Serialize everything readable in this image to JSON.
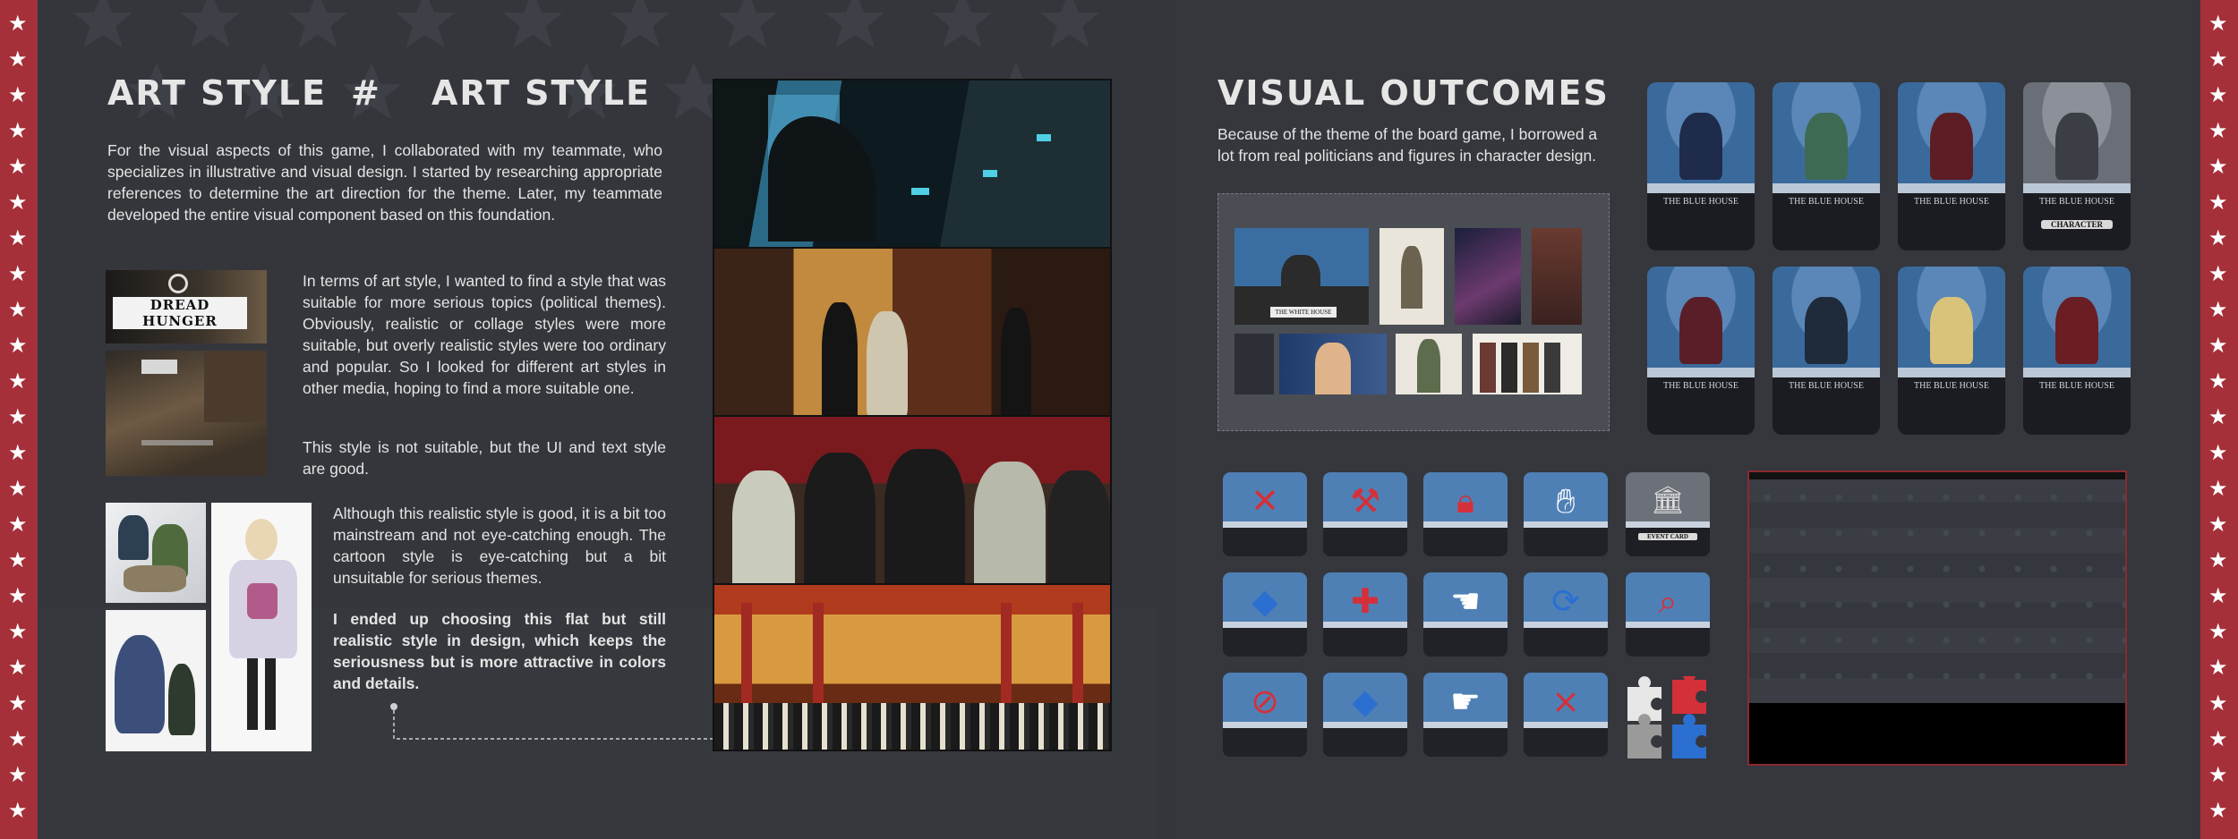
{
  "left": {
    "heading_left": "ART STYLE",
    "heading_symbol": "#",
    "heading_right": "ART STYLE",
    "intro": "For the visual aspects of this game, I collaborated with my teammate, who specializes in illustrative and visual design. I started by researching appropriate references to determine the art direction for the theme. Later, my teammate developed the entire visual component based on this foundation.",
    "para_style": "In terms of art style, I wanted to find a style that was suitable for more serious topics (political themes). Obviously, realistic or collage styles were more suitable, but overly realistic styles were too ordinary and popular. So I looked for different art styles in other media, hoping to find a more suitable one.",
    "para_unsuitable": "This style is not suitable, but the UI and text style are good.",
    "para_realistic": "Although this realistic style is good, it is a bit too mainstream and not eye-catching enough. The cartoon style is eye-catching but a bit unsuitable for serious themes.",
    "para_choice": "I ended up choosing this flat but still realistic style in design, which keeps the seriousness but is more attractive in colors and details.",
    "ref_logo_text": "DREAD HUNGER"
  },
  "right": {
    "heading": "VISUAL OUTCOMES",
    "intro": "Because of the theme of the board game, I borrowed a lot from real politicians and figures in character design.",
    "podium_sign": "THE WHITE HOUSE",
    "card_title": "THE BLUE HOUSE",
    "card_back_label": "CHARACTER",
    "event_card_label": "EVENT CARD",
    "colors": {
      "accent_red": "#a5303a",
      "card_blue": "#4f80b5",
      "background": "#34363b"
    }
  }
}
